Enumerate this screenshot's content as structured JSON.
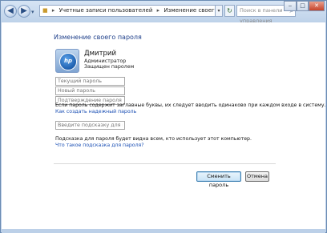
{
  "titlebar": {
    "breadcrumb": [
      "Учетные записи пользователей",
      "Изменение своего пароля"
    ],
    "search_placeholder": "Поиск в панели управления",
    "back": "◀",
    "forward": "▶",
    "history": "▾",
    "refresh": "↻",
    "minimize": "‒",
    "maximize": "□",
    "close": "✕"
  },
  "page": {
    "heading": "Изменение своего пароля"
  },
  "user": {
    "avatar_text": "hp",
    "name": "Дмитрий",
    "role": "Администратор",
    "protection": "Защищен паролем"
  },
  "form": {
    "current_password_placeholder": "Текущий пароль",
    "new_password_placeholder": "Новый пароль",
    "confirm_password_placeholder": "Подтверждение пароля",
    "case_note": "Если пароль содержит заглавные буквы, их следует вводить одинаково при каждом входе в систему.",
    "strong_password_link": "Как создать надежный пароль",
    "hint_placeholder": "Введите подсказку для пароля",
    "hint_note": "Подсказка для пароля будет видна всем, кто использует этот компьютер.",
    "hint_link": "Что такое подсказка для пароля?"
  },
  "buttons": {
    "change": "Сменить пароль",
    "cancel": "Отмена"
  },
  "colors": {
    "accent_link": "#1a4fb4",
    "heading": "#1e3f8a",
    "frame": "#bcd0e8"
  }
}
